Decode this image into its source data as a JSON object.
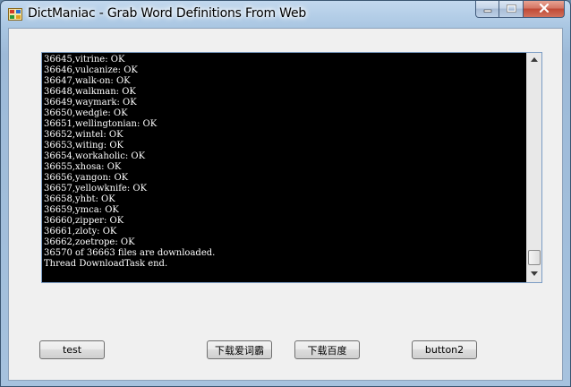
{
  "window": {
    "title": "DictManiac - Grab Word Definitions From Web"
  },
  "log": {
    "lines": [
      "36645,vitrine: OK",
      "36646,vulcanize: OK",
      "36647,walk-on: OK",
      "36648,walkman: OK",
      "36649,waymark: OK",
      "36650,wedgie: OK",
      "36651,wellingtonian: OK",
      "36652,wintel: OK",
      "36653,witing: OK",
      "36654,workaholic: OK",
      "36655,xhosa: OK",
      "36656,yangon: OK",
      "36657,yellowknife: OK",
      "36658,yhbt: OK",
      "36659,ymca: OK",
      "36660,zipper: OK",
      "36661,zloty: OK",
      "36662,zoetrope: OK",
      "36570 of 36663 files are downloaded.",
      "Thread DownloadTask end."
    ]
  },
  "buttons": {
    "test": "test",
    "iciba": "下载爱词霸",
    "baidu": "下载百度",
    "button2": "button2"
  },
  "icons": {
    "app": "dictionary-app-icon",
    "minimize": "minimize-icon",
    "maximize": "maximize-icon",
    "close": "close-icon",
    "scroll_up": "scroll-up-arrow-icon",
    "scroll_down": "scroll-down-arrow-icon"
  },
  "colors": {
    "log_background": "#000000",
    "log_text": "#ffffff",
    "close_button": "#c04a36",
    "window_frame": "#a9c6e2"
  }
}
